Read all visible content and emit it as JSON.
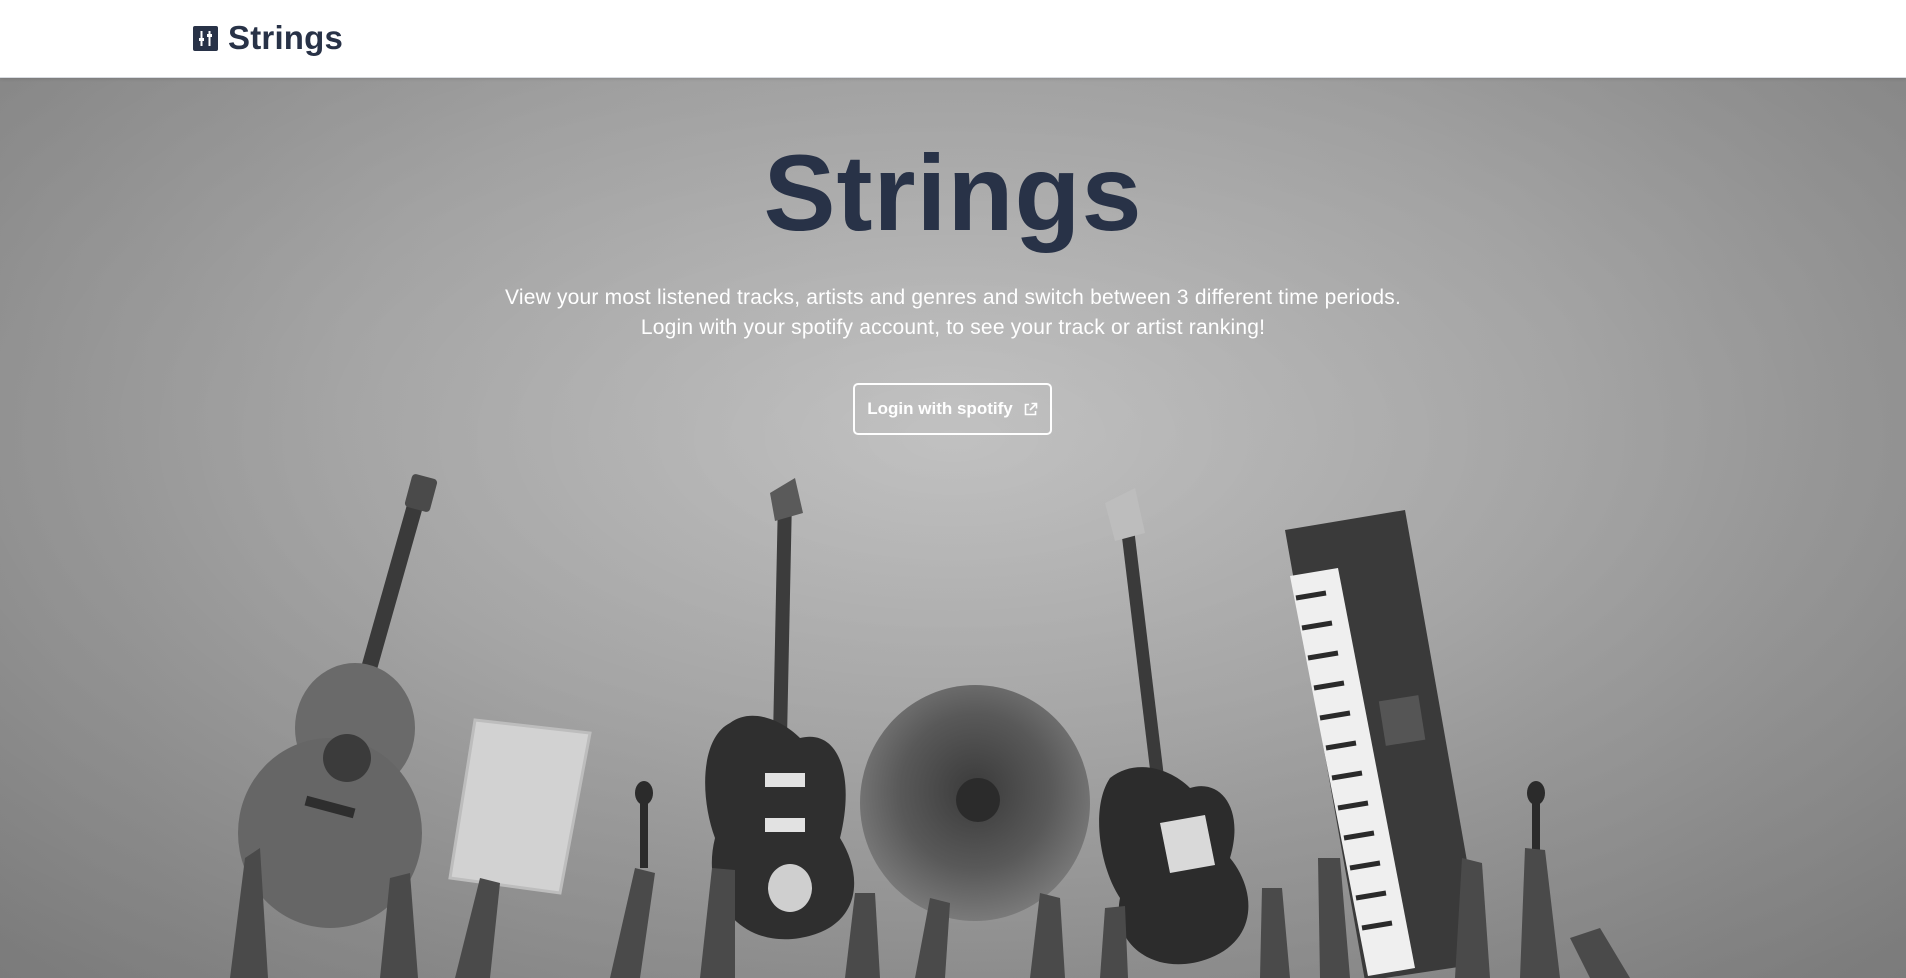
{
  "navbar": {
    "brand_icon": "sliders-icon",
    "brand_name": "Strings"
  },
  "hero": {
    "title": "Strings",
    "description_line1": "View your most listened tracks, artists and genres and switch between 3 different time periods.",
    "description_line2": "Login with your spotify account, to see your track or artist ranking!",
    "login_button_label": "Login with spotify",
    "login_button_icon": "external-link-icon",
    "background_image": "hands raising guitars, laptop, cymbal, bass, keyboard and microphones (grayscale photo)"
  },
  "colors": {
    "brand_text": "#283247",
    "hero_text": "#ffffff",
    "hero_background": "#b9b9b9"
  }
}
